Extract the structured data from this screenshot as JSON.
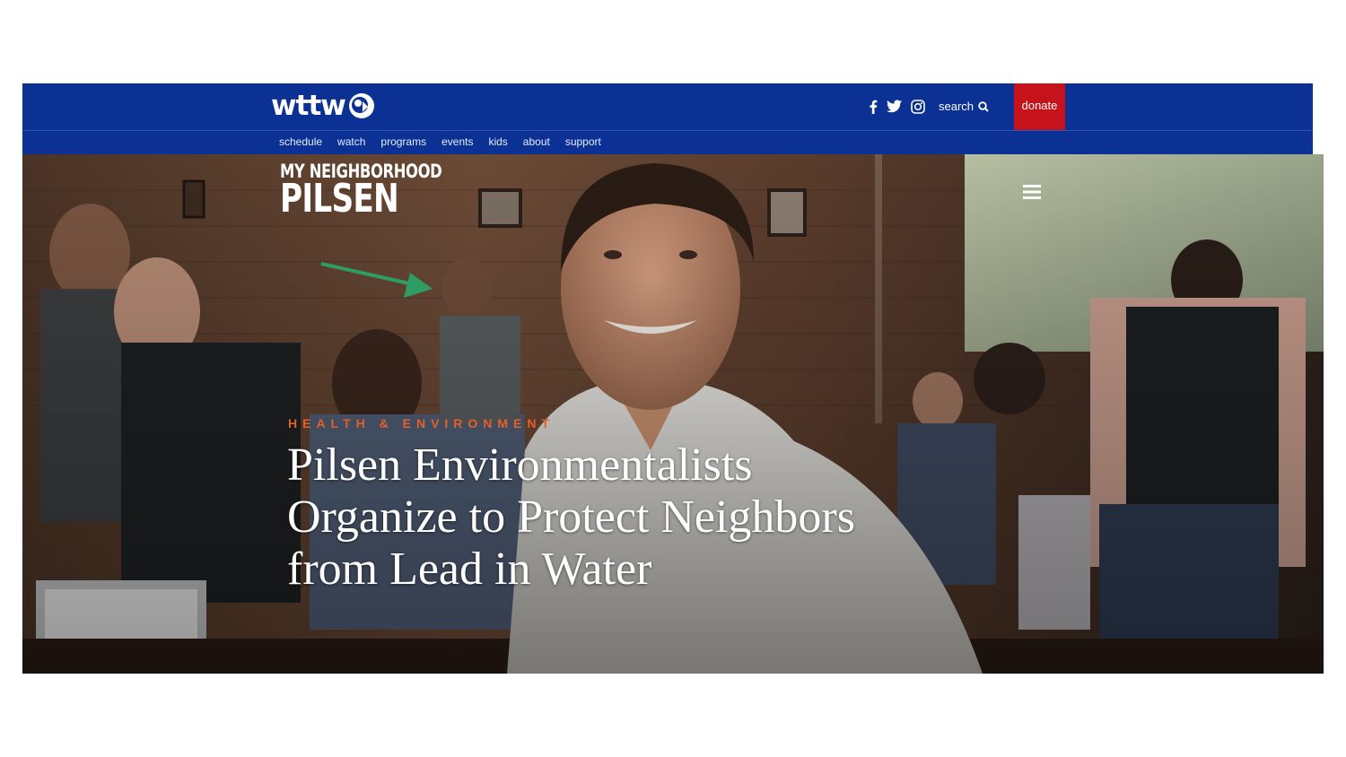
{
  "site": {
    "logo_text": "wttw",
    "search_label": "search",
    "donate_label": "donate",
    "social": [
      "facebook-icon",
      "twitter-icon",
      "instagram-icon"
    ]
  },
  "nav": {
    "items": [
      "schedule",
      "watch",
      "programs",
      "events",
      "kids",
      "about",
      "support"
    ]
  },
  "show": {
    "line1": "MY NEIGHBORHOOD",
    "line2": "PILSEN"
  },
  "article": {
    "category": "HEALTH & ENVIRONMENT",
    "headline": "Pilsen Environmentalists Organize to Protect Neighbors from Lead in Water"
  },
  "colors": {
    "header_blue": "#0a3193",
    "donate_red": "#c6121a",
    "category_orange": "#e2602a",
    "annotation_arrow_green": "#2e9d63"
  }
}
